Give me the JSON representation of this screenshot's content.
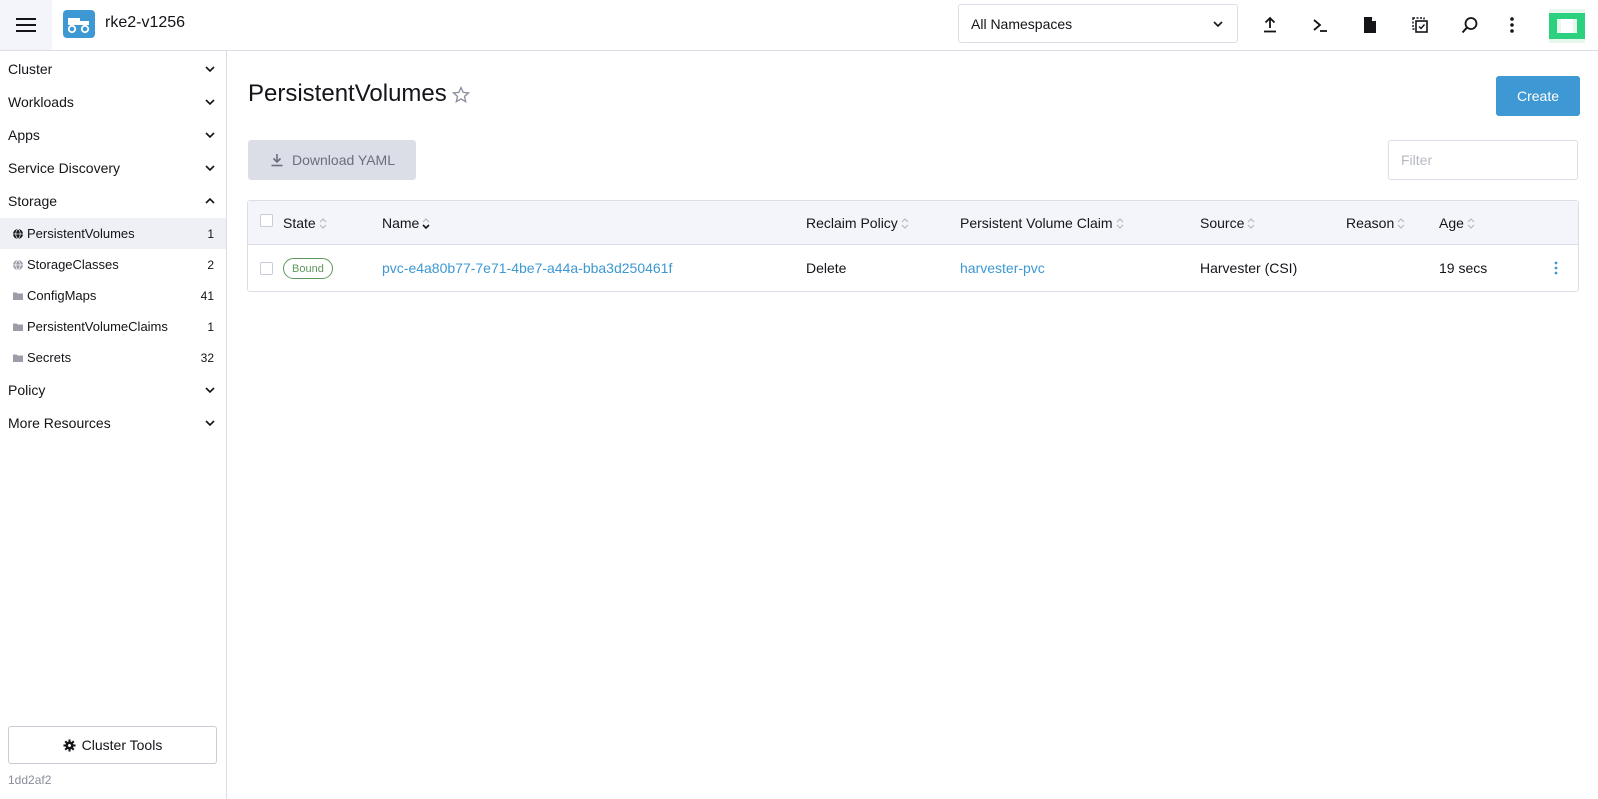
{
  "header": {
    "cluster_name": "rke2-v1256",
    "namespace_selected": "All Namespaces"
  },
  "sidebar": {
    "groups": [
      {
        "label": "Cluster"
      },
      {
        "label": "Workloads"
      },
      {
        "label": "Apps"
      },
      {
        "label": "Service Discovery"
      },
      {
        "label": "Storage"
      },
      {
        "label": "Policy"
      },
      {
        "label": "More Resources"
      }
    ],
    "storage_items": [
      {
        "label": "PersistentVolumes",
        "count": "1",
        "icon": "globe-icon"
      },
      {
        "label": "StorageClasses",
        "count": "2",
        "icon": "globe-icon"
      },
      {
        "label": "ConfigMaps",
        "count": "41",
        "icon": "folder-icon"
      },
      {
        "label": "PersistentVolumeClaims",
        "count": "1",
        "icon": "folder-icon"
      },
      {
        "label": "Secrets",
        "count": "32",
        "icon": "folder-icon"
      }
    ],
    "cluster_tools_label": "Cluster Tools",
    "version": "1dd2af2"
  },
  "main": {
    "title": "PersistentVolumes",
    "create_label": "Create",
    "download_label": "Download YAML",
    "filter_placeholder": "Filter",
    "columns": [
      "State",
      "Name",
      "Reclaim Policy",
      "Persistent Volume Claim",
      "Source",
      "Reason",
      "Age"
    ],
    "rows": [
      {
        "state": "Bound",
        "name": "pvc-e4a80b77-7e71-4be7-a44a-bba3d250461f",
        "reclaim_policy": "Delete",
        "claim": "harvester-pvc",
        "source": "Harvester (CSI)",
        "reason": "",
        "age": "19 secs"
      }
    ]
  },
  "colors": {
    "accent": "#3d98d3",
    "bound": "#5d995d",
    "header_bg": "#f4f5fa"
  }
}
